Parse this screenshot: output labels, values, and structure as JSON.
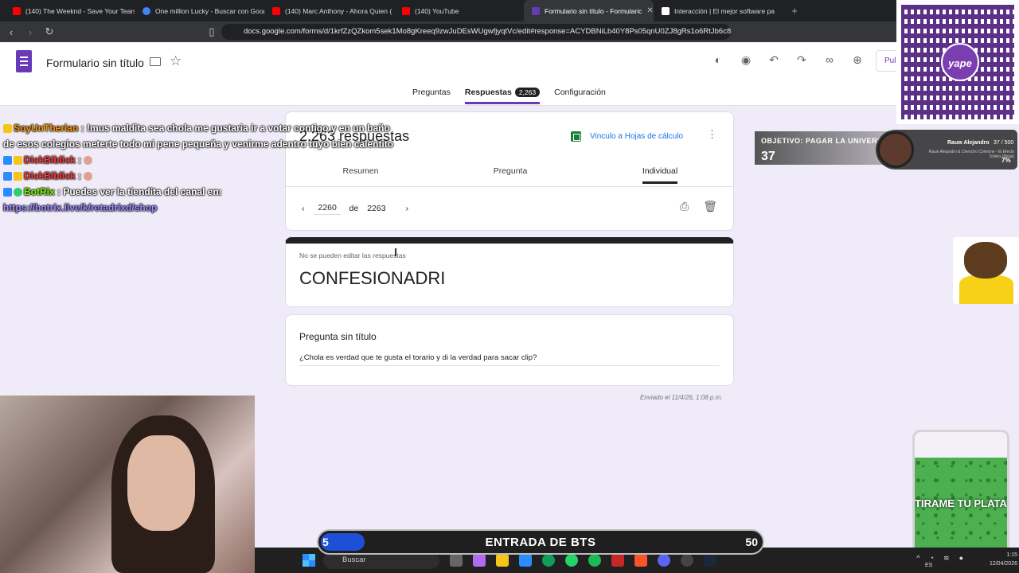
{
  "browser": {
    "tabs": [
      {
        "label": "(140) The Weeknd - Save Your Tears",
        "color": "#ff0000"
      },
      {
        "label": "One million Lucky - Buscar con Goog",
        "color": "#4285f4"
      },
      {
        "label": "(140) Marc Anthony - Ahora Quien (",
        "color": "#ff0000"
      },
      {
        "label": "(140) YouTube",
        "color": "#ff0000"
      },
      {
        "label": "Formulario sin título - Formularic",
        "color": "#673ab7",
        "active": true
      },
      {
        "label": "Interacción | El mejor software pa",
        "color": "#ffffff"
      }
    ],
    "url": "docs.google.com/forms/d/1krfZzQZkom5sek1Mo8gKreeq9zwJuDEsWUgwfjyqtVc/edit#response=ACYDBNiLb40Y8Ps05qnU0ZJ8gRs1o6RtJb6c8..."
  },
  "forms_header": {
    "title": "Formulario sin título",
    "publish_label": "Pul",
    "tabs": {
      "questions": "Preguntas",
      "responses": "Respuestas",
      "responses_count": "2,263",
      "settings": "Configuración"
    }
  },
  "responses_card": {
    "title": "2.263 respuestas",
    "sheets_link": "Vinculo a Hojas de cálculo",
    "subtabs": {
      "summary": "Resumen",
      "question": "Pregunta",
      "individual": "Individual"
    },
    "pager": {
      "current": "2260",
      "of_label": "de",
      "total": "2263"
    }
  },
  "form_card": {
    "notice": "No se pueden editar las respuestas",
    "name": "CONFESIONADRI"
  },
  "question_card": {
    "title": "Pregunta sin título",
    "answer": "¿Chola es verdad que te gusta el torario y di la verdad para sacar clip?"
  },
  "sent_label": "Enviado el 11/4/26, 1:08 p.m.",
  "chat": [
    {
      "user": "SoyUnTherian",
      "text": ": !mus maldita sea chola me gustaria ir a votar contigo y en un baño de esos colegios meterte todo mi pene pequeña y venirme adentro tuyo bien calentito",
      "user_color": "#ff9800"
    },
    {
      "user": "DickBiblick",
      "text": ":",
      "user_color": "#ff3b3b"
    },
    {
      "user": "DickBiblick",
      "text": ":",
      "user_color": "#ff3b3b"
    },
    {
      "user": "BotRix",
      "text": ": Puedes ver la tiendita del canal en:",
      "user_color": "#7cfc00"
    },
    {
      "user": "",
      "text": "https://botrix.live/k/retadrixd/shop",
      "user_color": "#9c8bff"
    }
  ],
  "goal": {
    "title": "OBJETIVO: PAGAR LA UNIVERSIDAD",
    "count": "37"
  },
  "now_playing": {
    "artist": "Rauw Alejandro",
    "progress": "37 / 500",
    "song": "Rauw Alejandro & Chencho Corleone - El Efecto (Video Oficial)",
    "percent": "7%"
  },
  "qr": {
    "brand": "yape"
  },
  "jar": {
    "label": "TIRAME TU PLATA"
  },
  "bts_bar": {
    "current": "5",
    "label": "ENTRADA DE BTS",
    "total": "50",
    "progress": 0.1
  },
  "taskbar": {
    "search": "Buscar",
    "lang": "ES",
    "time": "1:15",
    "date": "12/04/2026"
  }
}
